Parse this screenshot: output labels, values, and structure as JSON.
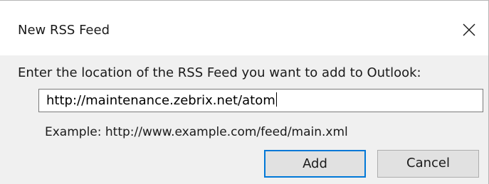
{
  "dialog": {
    "title": "New RSS Feed",
    "close_icon": "close-icon",
    "prompt": "Enter the location of the RSS Feed you want to add to Outlook:",
    "url_value": "http://maintenance.zebrix.net/atom",
    "example": "Example: http://www.example.com/feed/main.xml",
    "buttons": {
      "add_label": "Add",
      "cancel_label": "Cancel"
    }
  },
  "colors": {
    "content_bg": "#f0f0f0",
    "default_button_border": "#0078d7",
    "button_bg": "#e1e1e1"
  }
}
